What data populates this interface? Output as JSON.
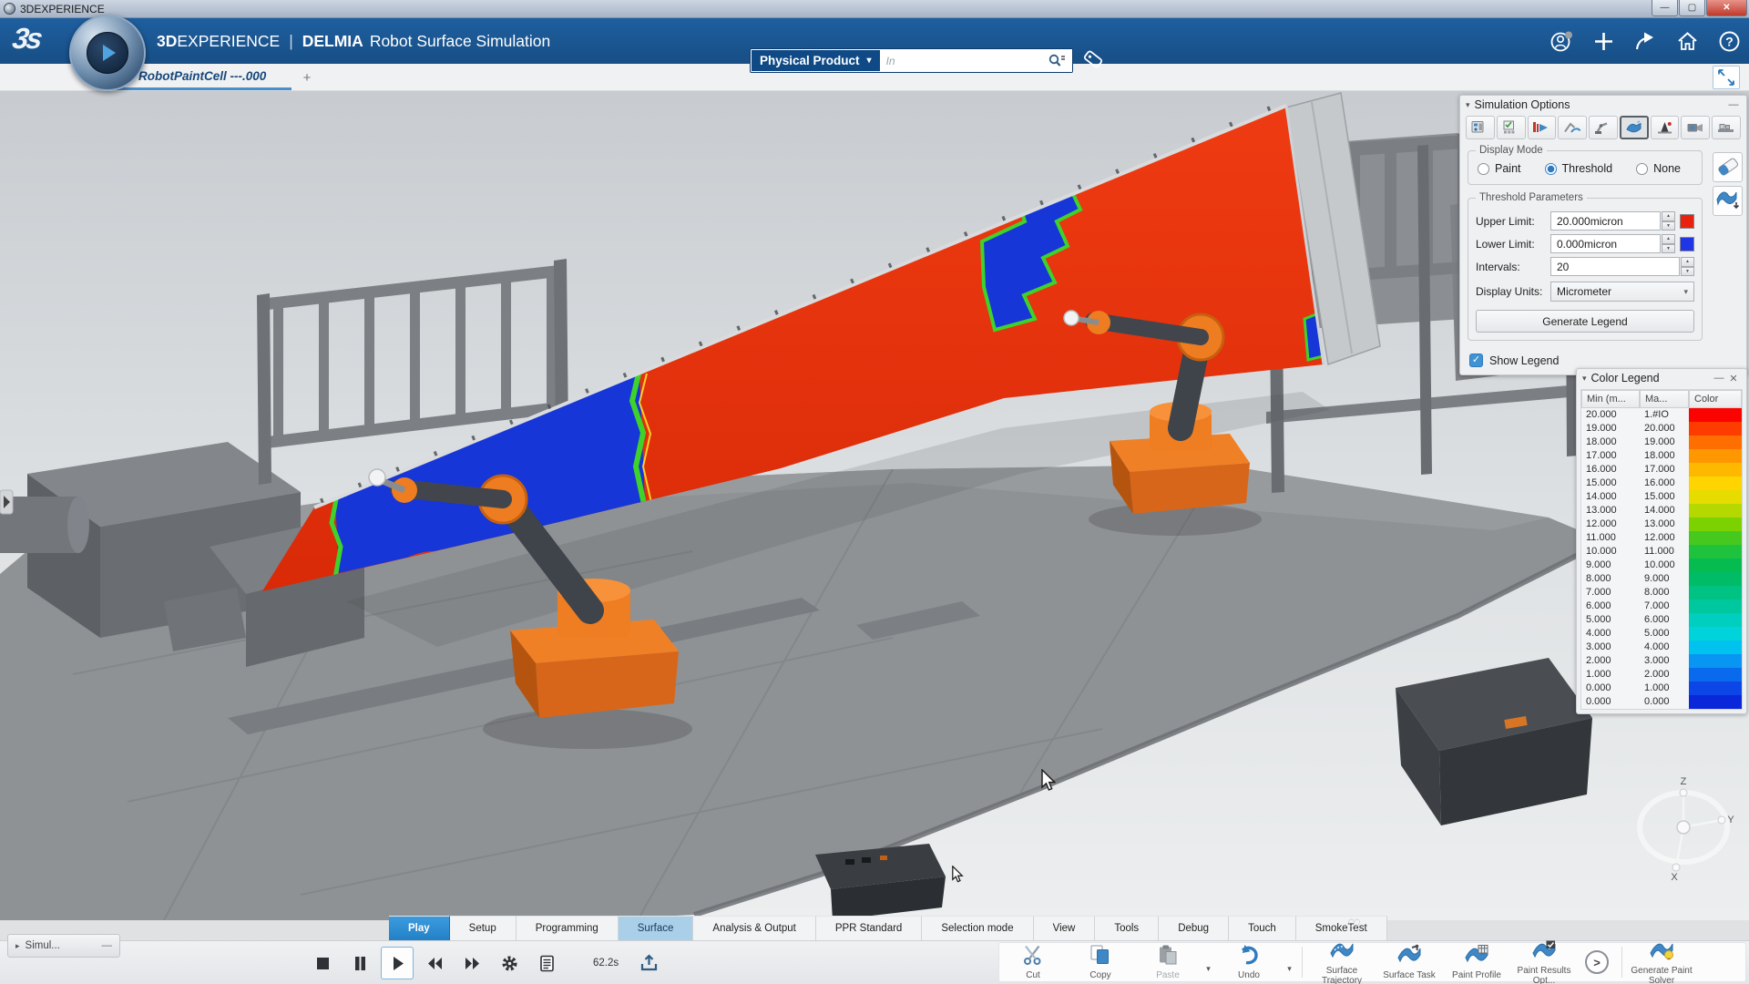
{
  "window": {
    "title": "3DEXPERIENCE",
    "controls": [
      "minimize",
      "restore",
      "close"
    ]
  },
  "header": {
    "brand_bold": "3D",
    "brand_rest": "EXPERIENCE",
    "divider": "|",
    "app_name": "DELMIA",
    "app_title": "Robot Surface Simulation",
    "search_scope": "Physical Product",
    "search_placeholder": "In",
    "actions": [
      "user",
      "add",
      "share",
      "home",
      "help"
    ]
  },
  "doc_tab": {
    "label": "RobotPaintCell ---.000",
    "new_tab": "+"
  },
  "viewport": {
    "axes": [
      "Z",
      "Y",
      "X"
    ]
  },
  "simulation_options": {
    "title": "Simulation Options",
    "tools": [
      "simulation-settings",
      "task-list",
      "process-flow",
      "collision-check",
      "robot-arm",
      "paint-spray",
      "probe-analysis",
      "camera-record",
      "conveyor"
    ],
    "active_tool": "paint-spray",
    "side_tools": [
      "eraser",
      "paint-fill"
    ],
    "display_mode": {
      "legend": "Display Mode",
      "options": [
        "Paint",
        "Threshold",
        "None"
      ],
      "selected": "Threshold"
    },
    "threshold_parameters": {
      "legend": "Threshold Parameters",
      "rows": [
        {
          "label": "Upper Limit:",
          "value": "20.000micron",
          "swatch": "#e8220e"
        },
        {
          "label": "Lower Limit:",
          "value": "0.000micron",
          "swatch": "#1f35e6"
        },
        {
          "label": "Intervals:",
          "value": "20"
        }
      ],
      "units_label": "Display Units:",
      "units_value": "Micrometer",
      "generate_button": "Generate Legend"
    },
    "show_legend_label": "Show Legend",
    "show_legend_checked": true
  },
  "color_legend": {
    "title": "Color Legend",
    "columns": [
      "Min (m...",
      "Ma...",
      "Color"
    ],
    "rows": [
      [
        "20.000",
        "1.#IO",
        "#fb0300"
      ],
      [
        "19.000",
        "20.000",
        "#ff3c00"
      ],
      [
        "18.000",
        "19.000",
        "#ff6e00"
      ],
      [
        "17.000",
        "18.000",
        "#ff9800"
      ],
      [
        "16.000",
        "17.000",
        "#ffb800"
      ],
      [
        "15.000",
        "16.000",
        "#ffd400"
      ],
      [
        "14.000",
        "15.000",
        "#e6dc00"
      ],
      [
        "13.000",
        "14.000",
        "#b4d800"
      ],
      [
        "12.000",
        "13.000",
        "#7cd200"
      ],
      [
        "11.000",
        "12.000",
        "#46c81e"
      ],
      [
        "10.000",
        "11.000",
        "#1ec23c"
      ],
      [
        "9.000",
        "10.000",
        "#06bc50"
      ],
      [
        "8.000",
        "9.000",
        "#00bc66"
      ],
      [
        "7.000",
        "8.000",
        "#00c282"
      ],
      [
        "6.000",
        "7.000",
        "#00c89e"
      ],
      [
        "5.000",
        "6.000",
        "#00cebe"
      ],
      [
        "4.000",
        "5.000",
        "#00d4da"
      ],
      [
        "3.000",
        "4.000",
        "#00c2ee"
      ],
      [
        "2.000",
        "3.000",
        "#0896f2"
      ],
      [
        "1.000",
        "2.000",
        "#0a6aee"
      ],
      [
        "0.000",
        "1.000",
        "#0c46e6"
      ],
      [
        "0.000",
        "0.000",
        "#0a28da"
      ]
    ]
  },
  "workbench_tabs": {
    "items": [
      "Play",
      "Setup",
      "Programming",
      "Surface",
      "Analysis & Output",
      "PPR Standard",
      "Selection mode",
      "View",
      "Tools",
      "Debug",
      "Touch",
      "SmokeTest"
    ],
    "active": "Play",
    "highlighted": "Surface"
  },
  "player": {
    "buttons": [
      "stop",
      "pause",
      "play",
      "rewind",
      "fast-forward",
      "settings",
      "report"
    ],
    "active_button": "play",
    "time": "62.2s",
    "export_icon": "export"
  },
  "edit_commands": [
    {
      "label": "Cut",
      "icon": "cut"
    },
    {
      "label": "Copy",
      "icon": "copy"
    },
    {
      "label": "Paste",
      "icon": "paste",
      "caret": true,
      "disabled": true
    },
    {
      "label": "Undo",
      "icon": "undo",
      "caret": true
    }
  ],
  "app_commands": [
    {
      "label": "Surface Trajectory",
      "icon": "surface-trajectory"
    },
    {
      "label": "Surface Task",
      "icon": "surface-task"
    },
    {
      "label": "Paint Profile",
      "icon": "paint-profile"
    },
    {
      "label": "Paint Results Opt...",
      "icon": "paint-results"
    }
  ],
  "more_command": {
    "label": "Generate Paint Solver",
    "icon": "generate-paint-solver"
  },
  "status_panel": {
    "label": "Simul..."
  }
}
